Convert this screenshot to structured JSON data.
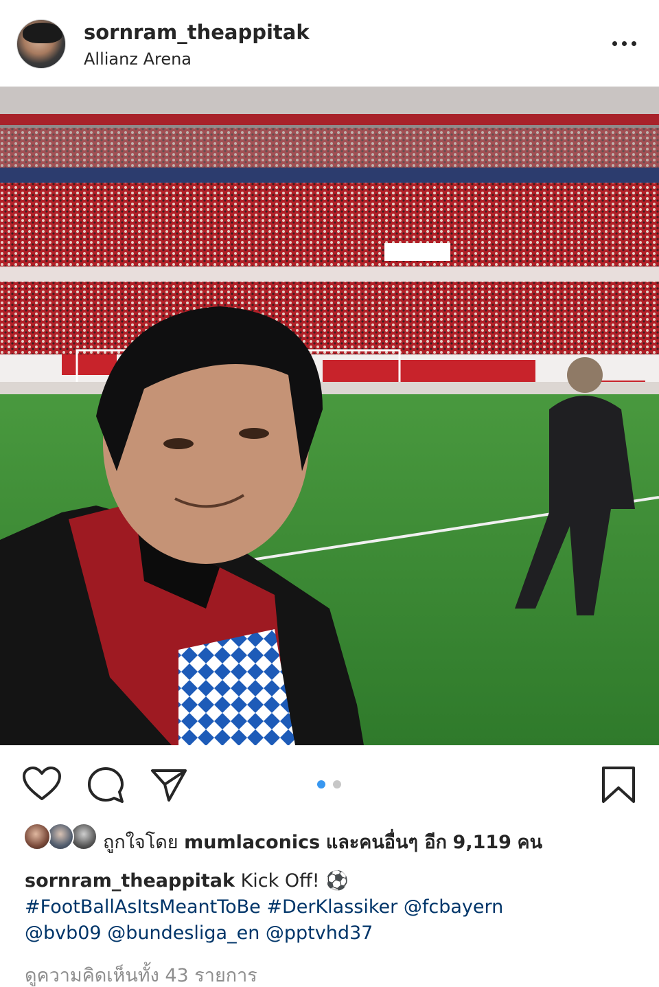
{
  "post": {
    "username": "sornram_theappitak",
    "location": "Allianz Arena"
  },
  "icons": {
    "more": "more-options-icon",
    "like": "heart-icon",
    "comment": "comment-icon",
    "share": "share-icon",
    "save": "bookmark-icon"
  },
  "carousel": {
    "current": 1,
    "total": 2,
    "active_color": "#3897f0",
    "inactive_color": "#c7c7c7"
  },
  "likes": {
    "prefix": "ถูกใจโดย",
    "first_user": "mumlaconics",
    "middle": "และคนอื่นๆ อีก",
    "count": "9,119",
    "suffix": "คน"
  },
  "caption": {
    "username": "sornram_theappitak",
    "text": "Kick Off! ⚽",
    "tags_line1": [
      "#FootBallAsItsMeantToBe",
      "#DerKlassiker",
      "@fcbayern"
    ],
    "tags_line2": [
      "@bvb09",
      "@bundesliga_en",
      "@pptvhd37"
    ]
  },
  "comments_link": "ดูความคิดเห็นทั้ง 43 รายการ",
  "colors": {
    "text": "#262626",
    "link": "#003569",
    "muted": "#8e8e8e",
    "stadium_red": "#c8232b",
    "pitch_green": "#3f8a36"
  }
}
